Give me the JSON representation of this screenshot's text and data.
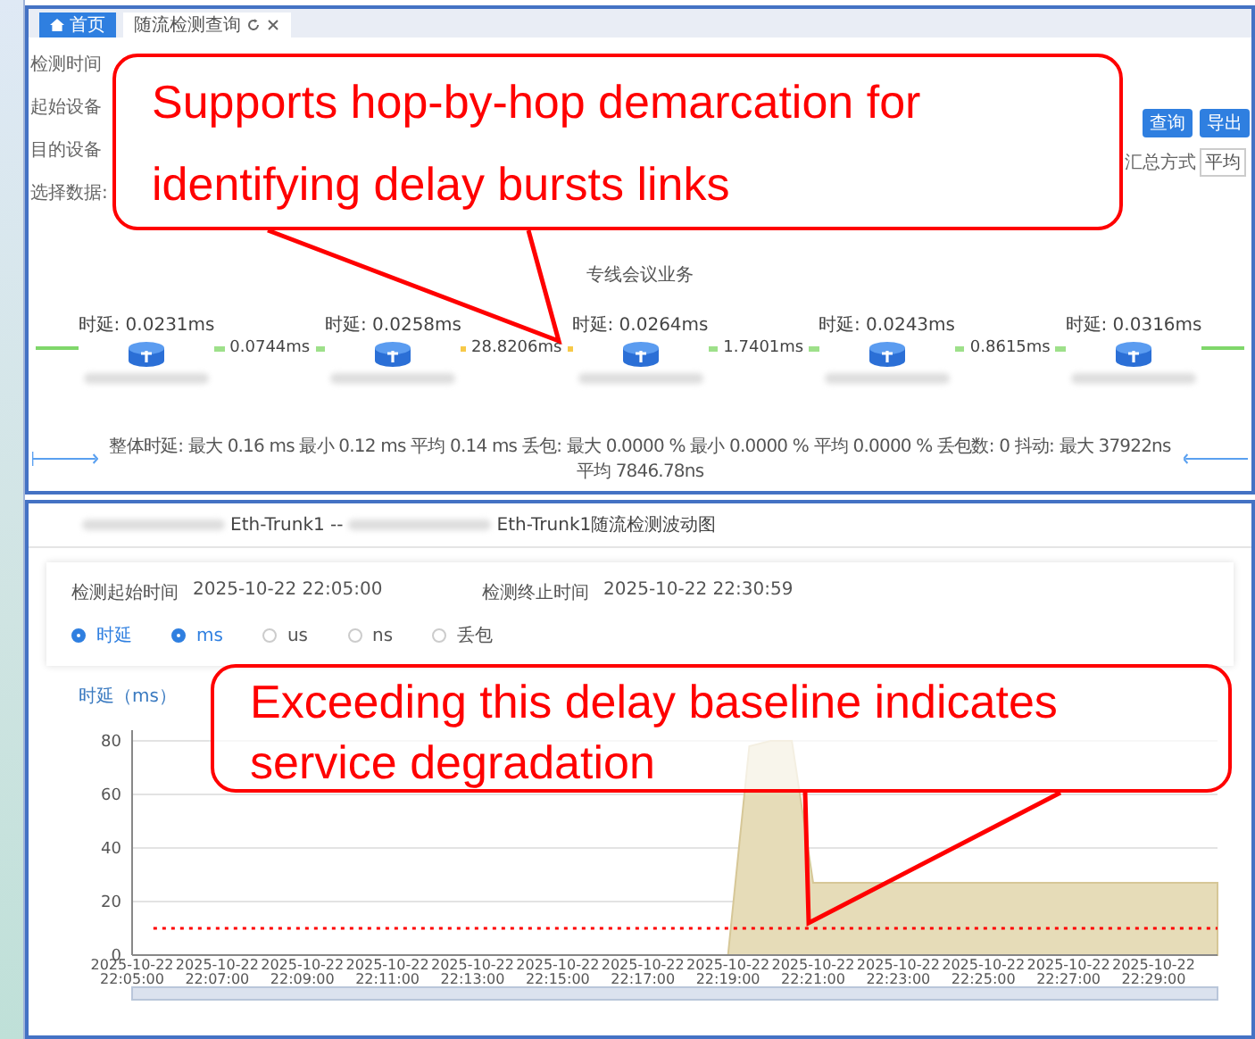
{
  "tabs": [
    {
      "label": "首页",
      "selected": true,
      "kind": "home"
    },
    {
      "label": "随流检测查询",
      "selected": false,
      "kind": "closable"
    }
  ],
  "form": {
    "labels": [
      "检测时间",
      "起始设备",
      "目的设备",
      "选择数据:"
    ],
    "buttons": [
      "查询",
      "导出"
    ],
    "summary": {
      "label": "汇总方式",
      "value": "平均"
    }
  },
  "service_title": "专线会议业务",
  "path": {
    "nodes": [
      {
        "delay": "时延: 0.0231ms"
      },
      {
        "delay": "时延: 0.0258ms"
      },
      {
        "delay": "时延: 0.0264ms"
      },
      {
        "delay": "时延: 0.0243ms"
      },
      {
        "delay": "时延: 0.0316ms"
      }
    ],
    "links": [
      {
        "value": "0.0744ms",
        "color": "#9ee08a"
      },
      {
        "value": "28.8206ms",
        "color": "#f7c948"
      },
      {
        "value": "1.7401ms",
        "color": "#9ee08a"
      },
      {
        "value": "0.8615ms",
        "color": "#9ee08a"
      }
    ],
    "summary": "整体时延: 最大 0.16 ms 最小 0.12 ms 平均 0.14 ms 丢包: 最大 0.0000 % 最小 0.0000 % 平均 0.0000 % 丢包数: 0 抖动: 最大 37922ns 平均 7846.78ns"
  },
  "detail": {
    "title_parts": [
      "Eth-Trunk1 --",
      "Eth-Trunk1随流检测波动图"
    ],
    "start": {
      "label": "检测起始时间",
      "value": "2025-10-22 22:05:00"
    },
    "end": {
      "label": "检测终止时间",
      "value": "2025-10-22 22:30:59"
    },
    "radios": [
      {
        "label": "时延",
        "selected": true
      },
      {
        "label": "ms",
        "selected": true
      },
      {
        "label": "us",
        "selected": false
      },
      {
        "label": "ns",
        "selected": false
      },
      {
        "label": "丢包",
        "selected": false
      }
    ],
    "chart_data": {
      "type": "area",
      "ylabel": "时延（ms）",
      "grid": true,
      "categories": [
        "2025-10-22 22:05:00",
        null,
        null,
        null,
        "2025-10-22 22:07:00",
        null,
        null,
        null,
        "2025-10-22 22:09:00",
        null,
        null,
        null,
        "2025-10-22 22:11:00",
        null,
        null,
        null,
        "2025-10-22 22:13:00",
        null,
        null,
        null,
        "2025-10-22 22:15:00",
        null,
        null,
        null,
        "2025-10-22 22:17:00",
        null,
        null,
        null,
        "2025-10-22 22:19:00",
        null,
        null,
        null,
        "2025-10-22 22:21:00",
        null,
        null,
        null,
        "2025-10-22 22:23:00",
        null,
        null,
        null,
        "2025-10-22 22:25:00",
        null,
        null,
        null,
        "2025-10-22 22:27:00",
        null,
        null,
        null,
        "2025-10-22 22:29:00",
        null,
        null,
        null
      ],
      "series": [
        {
          "color": "#e6dcb8",
          "values": [
            0,
            0,
            0,
            0,
            0,
            0,
            0,
            0,
            0,
            0,
            0,
            0,
            0,
            0,
            0,
            0,
            0,
            0,
            0,
            0,
            0,
            0,
            0,
            0,
            0,
            0,
            0,
            0,
            0,
            78,
            80,
            80,
            27,
            27,
            27,
            27,
            27,
            27,
            27,
            27,
            27,
            27,
            27,
            27,
            27,
            27,
            27,
            27,
            27,
            27,
            27,
            27
          ]
        },
        {
          "type": "line",
          "color": "#ff0000",
          "line_style": "dotted",
          "values": [
            null,
            10,
            10,
            10,
            10,
            10,
            10,
            10,
            10,
            10,
            10,
            10,
            10,
            10,
            10,
            10,
            10,
            10,
            10,
            10,
            10,
            10,
            10,
            10,
            10,
            10,
            10,
            10,
            10,
            10,
            10,
            10,
            10,
            10,
            10,
            10,
            10,
            10,
            10,
            10,
            10,
            10,
            10,
            10,
            10,
            10,
            10,
            10,
            10,
            10,
            10,
            10
          ]
        }
      ],
      "ylim": [
        0,
        80
      ],
      "yticks": [
        0,
        20,
        40,
        60,
        80
      ]
    }
  },
  "callouts": [
    {
      "text": "Supports hop-by-hop demarcation for identifying delay bursts links"
    },
    {
      "text": "Exceeding this delay baseline indicates service degradation"
    }
  ]
}
